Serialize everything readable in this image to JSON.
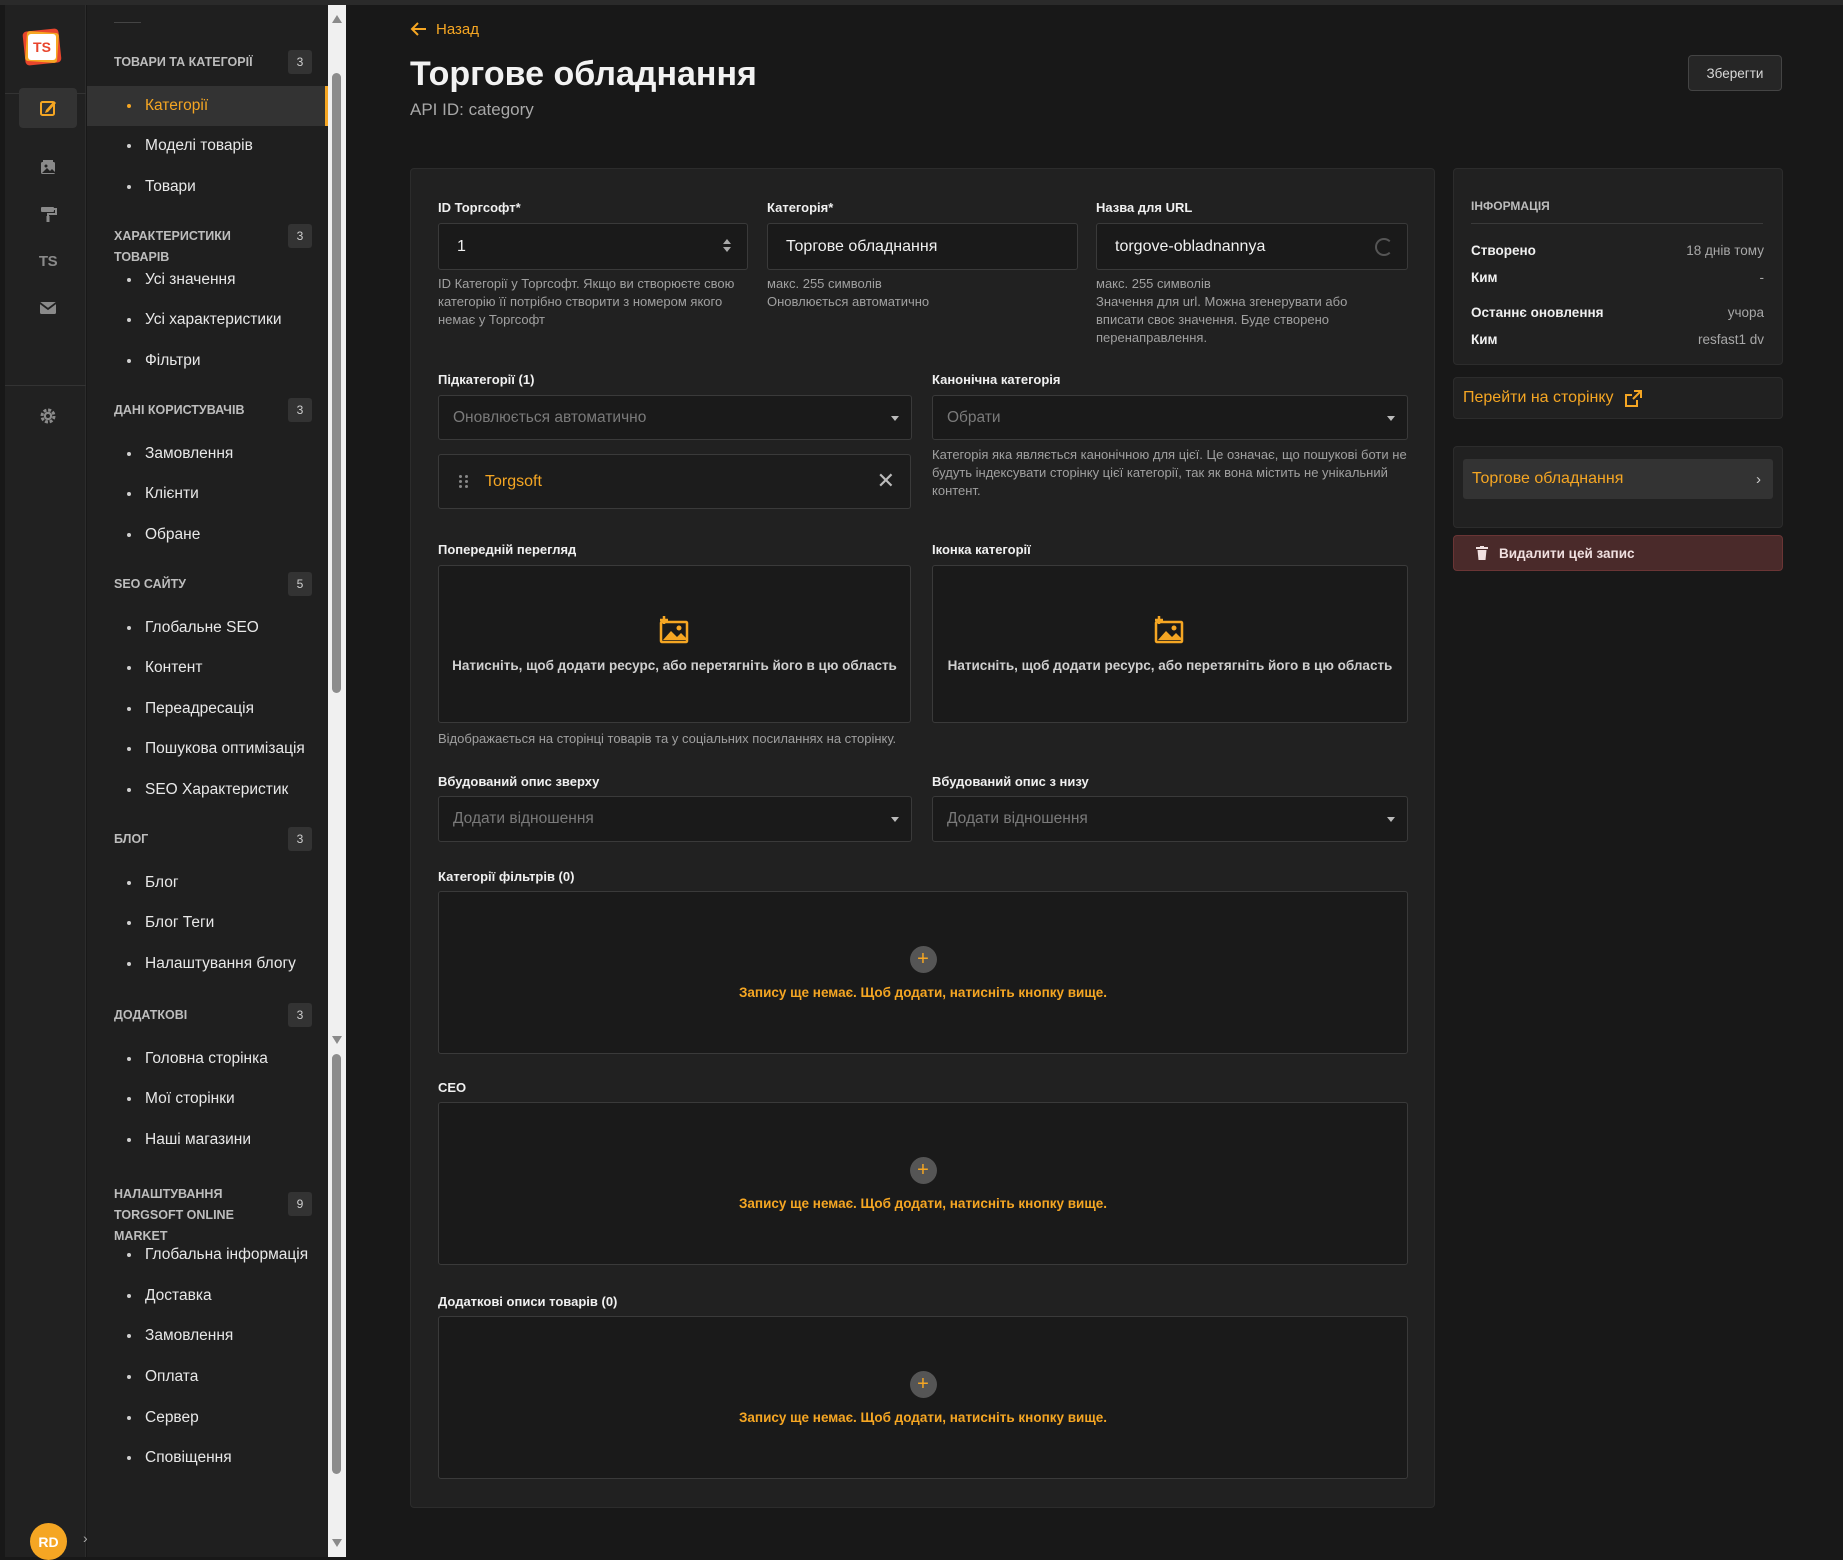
{
  "app": {
    "logo_text": "TS",
    "user_initials": "RD"
  },
  "colors": {
    "accent": "#f5a623",
    "background": "#181818",
    "panel": "#212121",
    "danger": "#4a2a2a"
  },
  "rail": {
    "icons": [
      "content-manager-icon",
      "media-library-icon",
      "paint-roller-icon",
      "ts-plugin-icon",
      "email-icon",
      "settings-icon"
    ],
    "ts_label": "TS"
  },
  "sidebar": {
    "sections": [
      {
        "title": "ТОВАРИ ТА КАТЕГОРІЇ",
        "count": "3",
        "items": [
          "Категорії",
          "Моделі товарів",
          "Товари"
        ]
      },
      {
        "title": "ХАРАКТЕРИСТИКИ ТОВАРІВ",
        "count": "3",
        "items": [
          "Усі значення",
          "Усі характеристики",
          "Фільтри"
        ]
      },
      {
        "title": "ДАНІ КОРИСТУВАЧІВ",
        "count": "3",
        "items": [
          "Замовлення",
          "Клієнти",
          "Обране"
        ]
      },
      {
        "title": "SEO САЙТУ",
        "count": "5",
        "items": [
          "Глобальне SEO",
          "Контент",
          "Переадресація",
          "Пошукова оптимізація",
          "SEO Характеристик"
        ]
      },
      {
        "title": "БЛОГ",
        "count": "3",
        "items": [
          "Блог",
          "Блог Теги",
          "Налаштування блогу"
        ]
      },
      {
        "title": "ДОДАТКОВІ",
        "count": "3",
        "items": [
          "Головна сторінка",
          "Мої сторінки",
          "Наші магазини"
        ]
      },
      {
        "title_line1": "НАЛАШТУВАННЯ",
        "title_line2": "TORGSOFT ONLINE MARKET",
        "count": "9",
        "items": [
          "Глобальна інформація",
          "Доставка",
          "Замовлення",
          "Оплата",
          "Сервер",
          "Сповіщення"
        ]
      }
    ],
    "active_item": "Категорії"
  },
  "header": {
    "back_label": "Назад",
    "title": "Торгове обладнання",
    "api_id": "API ID: category",
    "save_label": "Зберегти"
  },
  "form": {
    "torgsoft_id": {
      "label": "ID Торгсофт*",
      "value": "1",
      "hint": "ID Категорії у Торгсофт. Якщо ви створюєте свою категорію її потрібно створити з номером якого немає у Торгсофт"
    },
    "category": {
      "label": "Категорія*",
      "value": "Торгове обладнання",
      "hint_line1": "макс. 255 символів",
      "hint_line2": "Оновлюється автоматично"
    },
    "url_name": {
      "label": "Назва для URL",
      "value": "torgove-obladnannya",
      "hint_line1": "макс. 255 символів",
      "hint_line2": "Значення для url. Можна згенерувати або вписати своє значення. Буде створено перенаправлення."
    },
    "subcategories": {
      "label": "Підкатегорії (1)",
      "placeholder": "Оновлюється автоматично",
      "chip": "Torgsoft"
    },
    "canonical": {
      "label": "Канонічна категорія",
      "placeholder": "Обрати",
      "hint": "Категорія яка являється канонічною для цієї. Це означає, що пошукові боти не будуть індексувати сторінку цієї категорії, так як вона містить не унікальний контент."
    },
    "preview": {
      "label": "Попередній перегляд",
      "drop_text": "Натисніть, щоб додати ресурс, або перетягніть його в цю область",
      "hint": "Відображається на сторінці товарів та у соціальних посиланнях на сторінку."
    },
    "icon": {
      "label": "Іконка категорії",
      "drop_text": "Натисніть, щоб додати ресурс, або перетягніть його в цю область"
    },
    "desc_top": {
      "label": "Вбудований опис зверху",
      "placeholder": "Додати відношення"
    },
    "desc_bottom": {
      "label": "Вбудований опис з низу",
      "placeholder": "Додати відношення"
    },
    "filter_categories": {
      "label": "Категорії фільтрів (0)",
      "empty_text": "Запису ще немає. Щоб додати, натисніть кнопку вище."
    },
    "seo": {
      "label": "СЕО",
      "empty_text": "Запису ще немає. Щоб додати, натисніть кнопку вище."
    },
    "extra_desc": {
      "label": "Додаткові описи товарів (0)",
      "empty_text": "Запису ще немає. Щоб додати, натисніть кнопку вище."
    }
  },
  "info": {
    "heading": "ІНФОРМАЦІЯ",
    "created_label": "Створено",
    "created_value": "18 днів тому",
    "by1_label": "Ким",
    "by1_value": "-",
    "updated_label": "Останнє оновлення",
    "updated_value": "учора",
    "by2_label": "Ким",
    "by2_value": "resfast1 dv"
  },
  "actions": {
    "goto_page": "Перейти на сторінку",
    "related_item": "Торгове обладнання",
    "delete_label": "Видалити цей запис"
  }
}
